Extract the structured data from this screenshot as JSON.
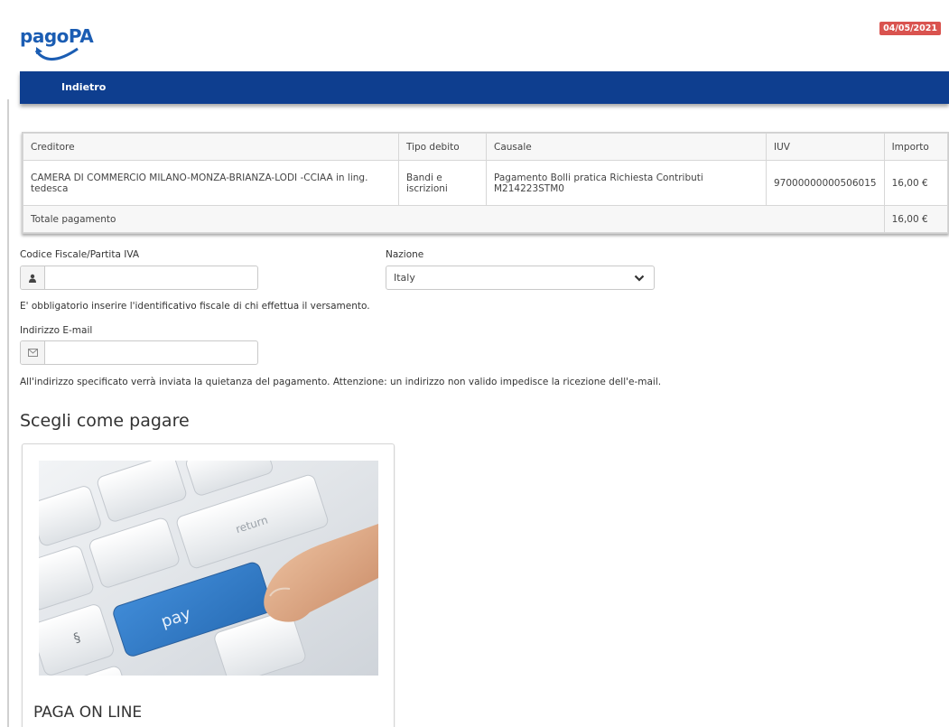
{
  "logo": {
    "text": "pagoPA"
  },
  "date_badge": "04/05/2021",
  "nav": {
    "back_label": "Indietro"
  },
  "table": {
    "headers": [
      "Creditore",
      "Tipo debito",
      "Causale",
      "IUV",
      "Importo"
    ],
    "rows": [
      {
        "creditore": "CAMERA DI COMMERCIO MILANO-MONZA-BRIANZA-LODI -CCIAA in ling. tedesca",
        "tipo_debito": "Bandi e iscrizioni",
        "causale": "Pagamento Bolli pratica Richiesta Contributi M214223STM0",
        "iuv": "97000000000506015",
        "importo": "16,00 €"
      }
    ],
    "total_label": "Totale pagamento",
    "total_value": "16,00 €"
  },
  "form": {
    "cf_label": "Codice Fiscale/Partita IVA",
    "cf_value": "",
    "cf_help": "E' obbligatorio inserire l'identificativo fiscale di chi effettua il versamento.",
    "nazione_label": "Nazione",
    "nazione_value": "Italy",
    "email_label": "Indirizzo E-mail",
    "email_value": "",
    "email_help": "All'indirizzo specificato verrà inviata la quietanza del pagamento. Attenzione: un indirizzo non valido impedisce la ricezione dell'e-mail."
  },
  "payment": {
    "heading": "Scegli come pagare",
    "option_title": "PAGA ON LINE",
    "image_key_pay": "pay",
    "image_key_return": "return",
    "image_key_section": "§"
  },
  "colors": {
    "brand_blue": "#0e3e8f",
    "logo_blue": "#1b5db3",
    "badge_red": "#d9534f"
  },
  "icons": {
    "user": "user-icon",
    "email": "envelope-icon",
    "dropdown": "chevron-down-icon"
  }
}
